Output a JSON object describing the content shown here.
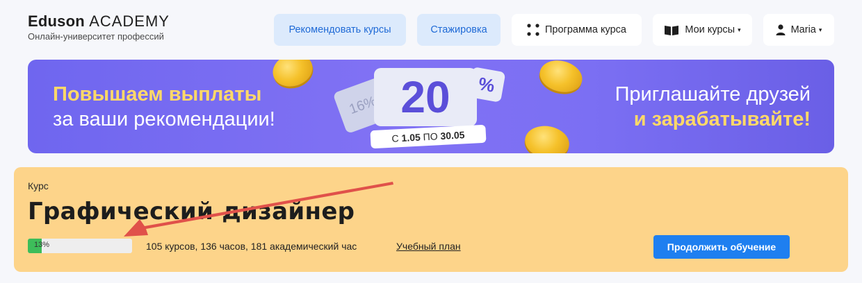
{
  "header": {
    "logo_brand": "Eduson",
    "logo_academy": "ACADEMY",
    "logo_tagline": "Онлайн-университет профессий",
    "recommend_label": "Рекомендовать курсы",
    "internship_label": "Стажировка",
    "program_label": "Программа курса",
    "my_courses_label": "Мои курсы",
    "user_name": "Maria",
    "caret": "▾"
  },
  "banner": {
    "left_line1": "Повышаем выплаты",
    "left_line2": "за ваши рекомендации!",
    "right_line1": "Приглашайте друзей",
    "right_line2": "и зарабатывайте!",
    "old_percent": "16%",
    "discount_value": "20",
    "percent_sign": "%",
    "date_prefix": "С",
    "date_start": "1.05",
    "date_mid": "ПО",
    "date_end": "30.05"
  },
  "course": {
    "label": "Курс",
    "title": "Графический дизайнер",
    "progress": 0.13,
    "progress_text": "13%",
    "stats": "105 курсов, 136 часов, 181 академический час",
    "plan_link": "Учебный план",
    "continue_label": "Продолжить обучение"
  },
  "colors": {
    "accent_blue": "#1e7ff0",
    "progress_green": "#3dbd5a",
    "card_bg": "#fdd48a",
    "banner_purple": "#7b6ff3",
    "highlight_yellow": "#ffd968",
    "arrow_red": "#e0514a"
  },
  "icons": {
    "program": "grid-dots-icon",
    "my_courses": "open-book-icon",
    "user": "user-icon"
  }
}
